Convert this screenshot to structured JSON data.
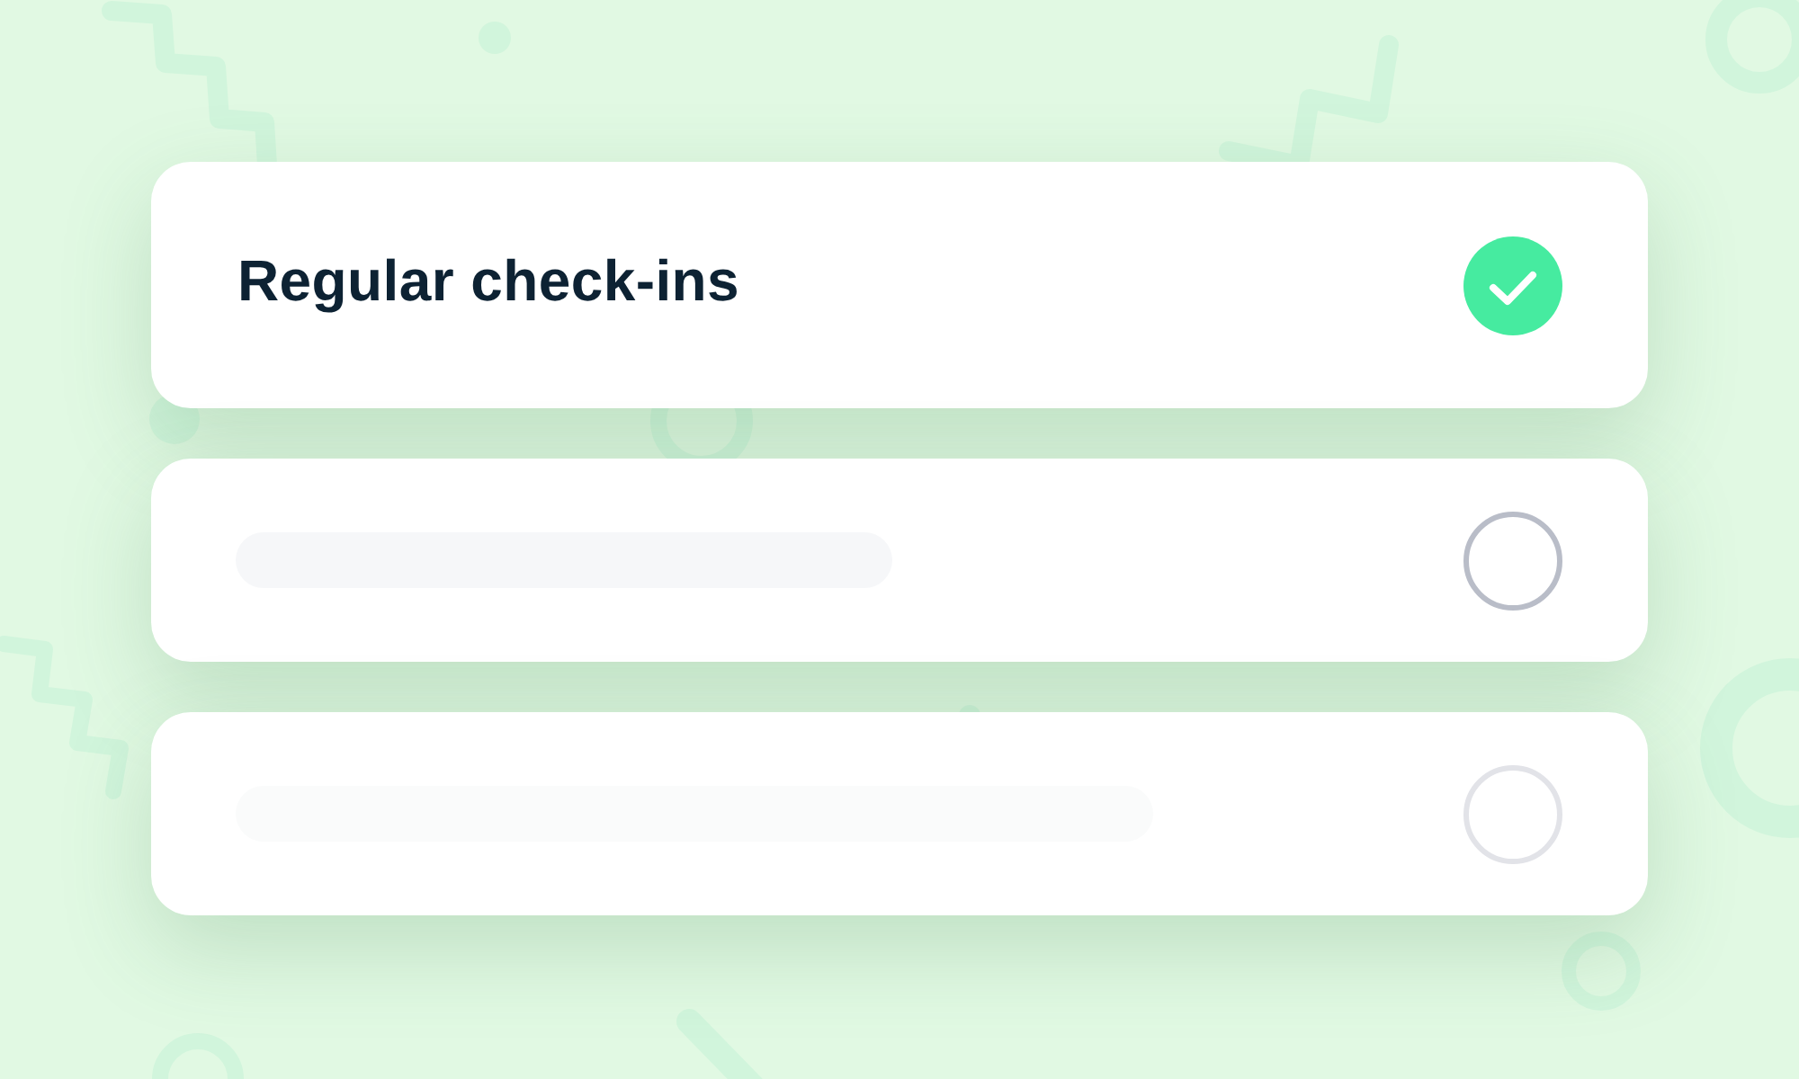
{
  "items": [
    {
      "kind": "text",
      "label": "Regular check-ins",
      "checked": true,
      "faded": false
    },
    {
      "kind": "placeholder",
      "checked": false,
      "faded": false
    },
    {
      "kind": "placeholder",
      "checked": false,
      "faded": true
    }
  ]
}
